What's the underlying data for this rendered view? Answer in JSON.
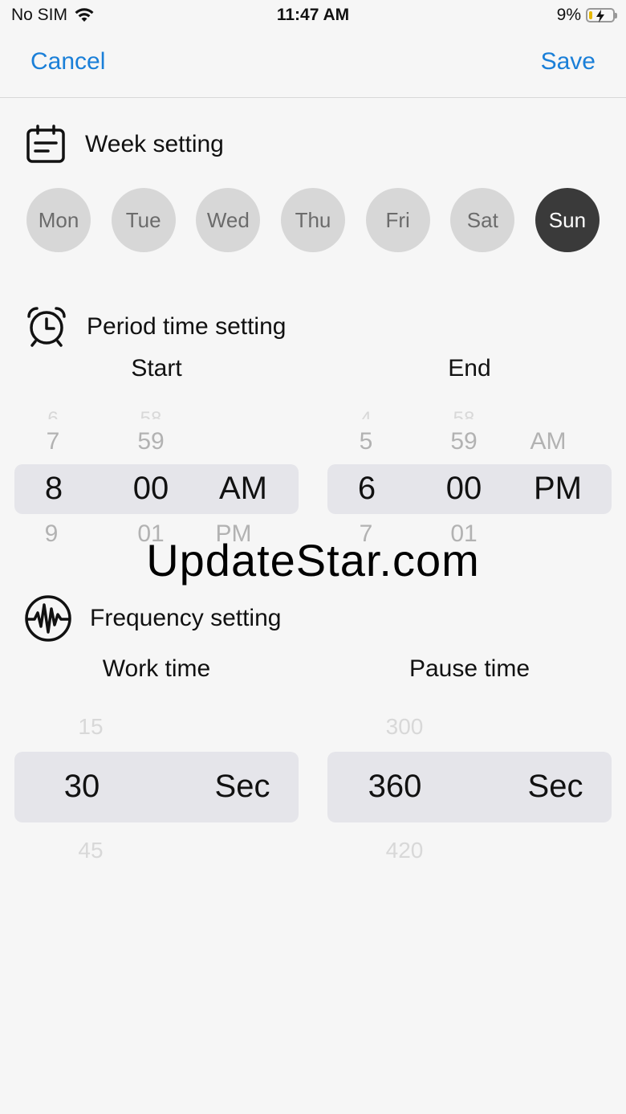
{
  "status_bar": {
    "carrier": "No SIM",
    "time": "11:47 AM",
    "battery_percent": "9%"
  },
  "nav": {
    "cancel_label": "Cancel",
    "save_label": "Save"
  },
  "week": {
    "title": "Week setting",
    "days": [
      {
        "label": "Mon",
        "selected": false
      },
      {
        "label": "Tue",
        "selected": false
      },
      {
        "label": "Wed",
        "selected": false
      },
      {
        "label": "Thu",
        "selected": false
      },
      {
        "label": "Fri",
        "selected": false
      },
      {
        "label": "Sat",
        "selected": false
      },
      {
        "label": "Sun",
        "selected": true
      }
    ]
  },
  "period": {
    "title": "Period time setting",
    "start": {
      "label": "Start",
      "hour": {
        "above": "7",
        "selected": "8",
        "below": "9"
      },
      "minute": {
        "above": "59",
        "selected": "00",
        "below": "01"
      },
      "ampm": {
        "selected": "AM",
        "below": "PM"
      }
    },
    "end": {
      "label": "End",
      "hour": {
        "above": "5",
        "selected": "6",
        "below": "7"
      },
      "minute": {
        "above": "59",
        "selected": "00",
        "below": "01"
      },
      "ampm": {
        "above": "AM",
        "selected": "PM"
      }
    }
  },
  "watermark": "UpdateStar.com",
  "frequency": {
    "title": "Frequency setting",
    "work": {
      "label": "Work time",
      "above": "15",
      "selected": "30",
      "below": "45",
      "unit": "Sec"
    },
    "pause": {
      "label": "Pause time",
      "above": "300",
      "selected": "360",
      "below": "420",
      "unit": "Sec"
    }
  },
  "colors": {
    "accent": "#1a7fd8",
    "day_selected": "#3a3a3a",
    "day_unselected": "#d7d7d7",
    "picker_band": "#e5e5ea"
  }
}
